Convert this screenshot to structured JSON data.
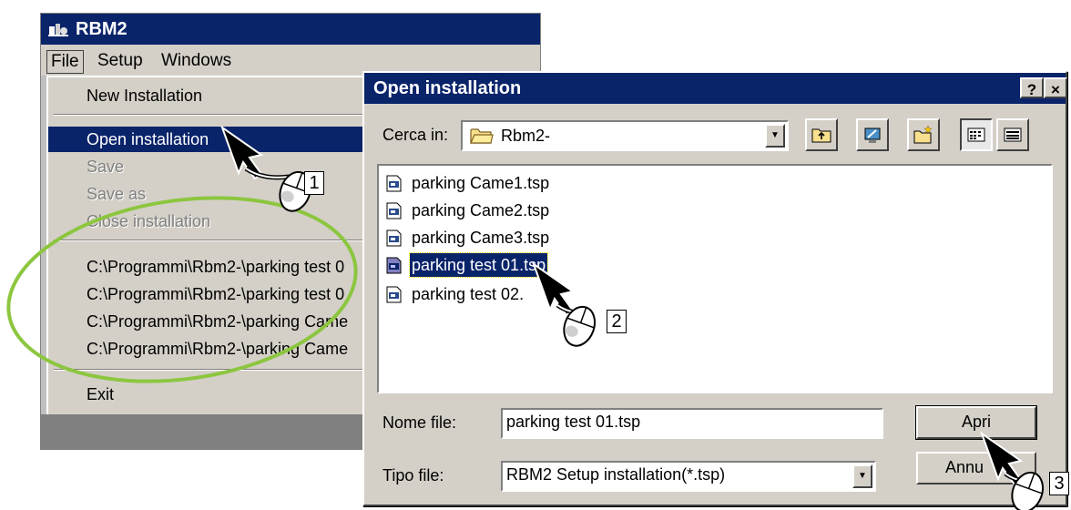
{
  "main_window": {
    "title": "RBM2",
    "menu": {
      "file": "File",
      "setup": "Setup",
      "windows": "Windows"
    }
  },
  "file_menu": {
    "items": [
      {
        "label": "New Installation",
        "state": "normal"
      },
      {
        "label": "Open installation",
        "state": "highlighted"
      },
      {
        "label": "Save",
        "state": "disabled"
      },
      {
        "label": "Save as",
        "state": "disabled"
      },
      {
        "label": "Close installation",
        "state": "disabled"
      }
    ],
    "recent": [
      "C:\\Programmi\\Rbm2-\\parking test 0",
      "C:\\Programmi\\Rbm2-\\parking test 0",
      "C:\\Programmi\\Rbm2-\\parking Came",
      "C:\\Programmi\\Rbm2-\\parking Came"
    ],
    "exit": "Exit"
  },
  "dialog": {
    "title": "Open installation",
    "help_label": "?",
    "close_label": "×",
    "look_in_label": "Cerca in:",
    "look_in_value": "Rbm2-",
    "files": [
      {
        "name": "parking Came1.tsp",
        "selected": false
      },
      {
        "name": "parking Came2.tsp",
        "selected": false
      },
      {
        "name": "parking Came3.tsp",
        "selected": false
      },
      {
        "name": "parking test 01.tsp",
        "selected": true
      },
      {
        "name": "parking test 02.",
        "selected": false
      }
    ],
    "file_name_label": "Nome file:",
    "file_name_value": "parking test 01.tsp",
    "file_type_label": "Tipo file:",
    "file_type_value": "RBM2 Setup installation(*.tsp)",
    "open_button": "Apri",
    "cancel_button": "Annu"
  },
  "annotations": {
    "step1": "1",
    "step2": "2",
    "step3": "3"
  },
  "colors": {
    "titlebar": "#0a246a",
    "face": "#d4d0c8",
    "highlight_ring": "#8cc63f"
  },
  "icons": [
    "app-icon",
    "folder-icon",
    "up-folder-icon",
    "desktop-icon",
    "new-folder-icon",
    "list-view-icon",
    "details-view-icon",
    "tsp-file-icon",
    "mouse-icon",
    "arrow-pointer-icon"
  ]
}
